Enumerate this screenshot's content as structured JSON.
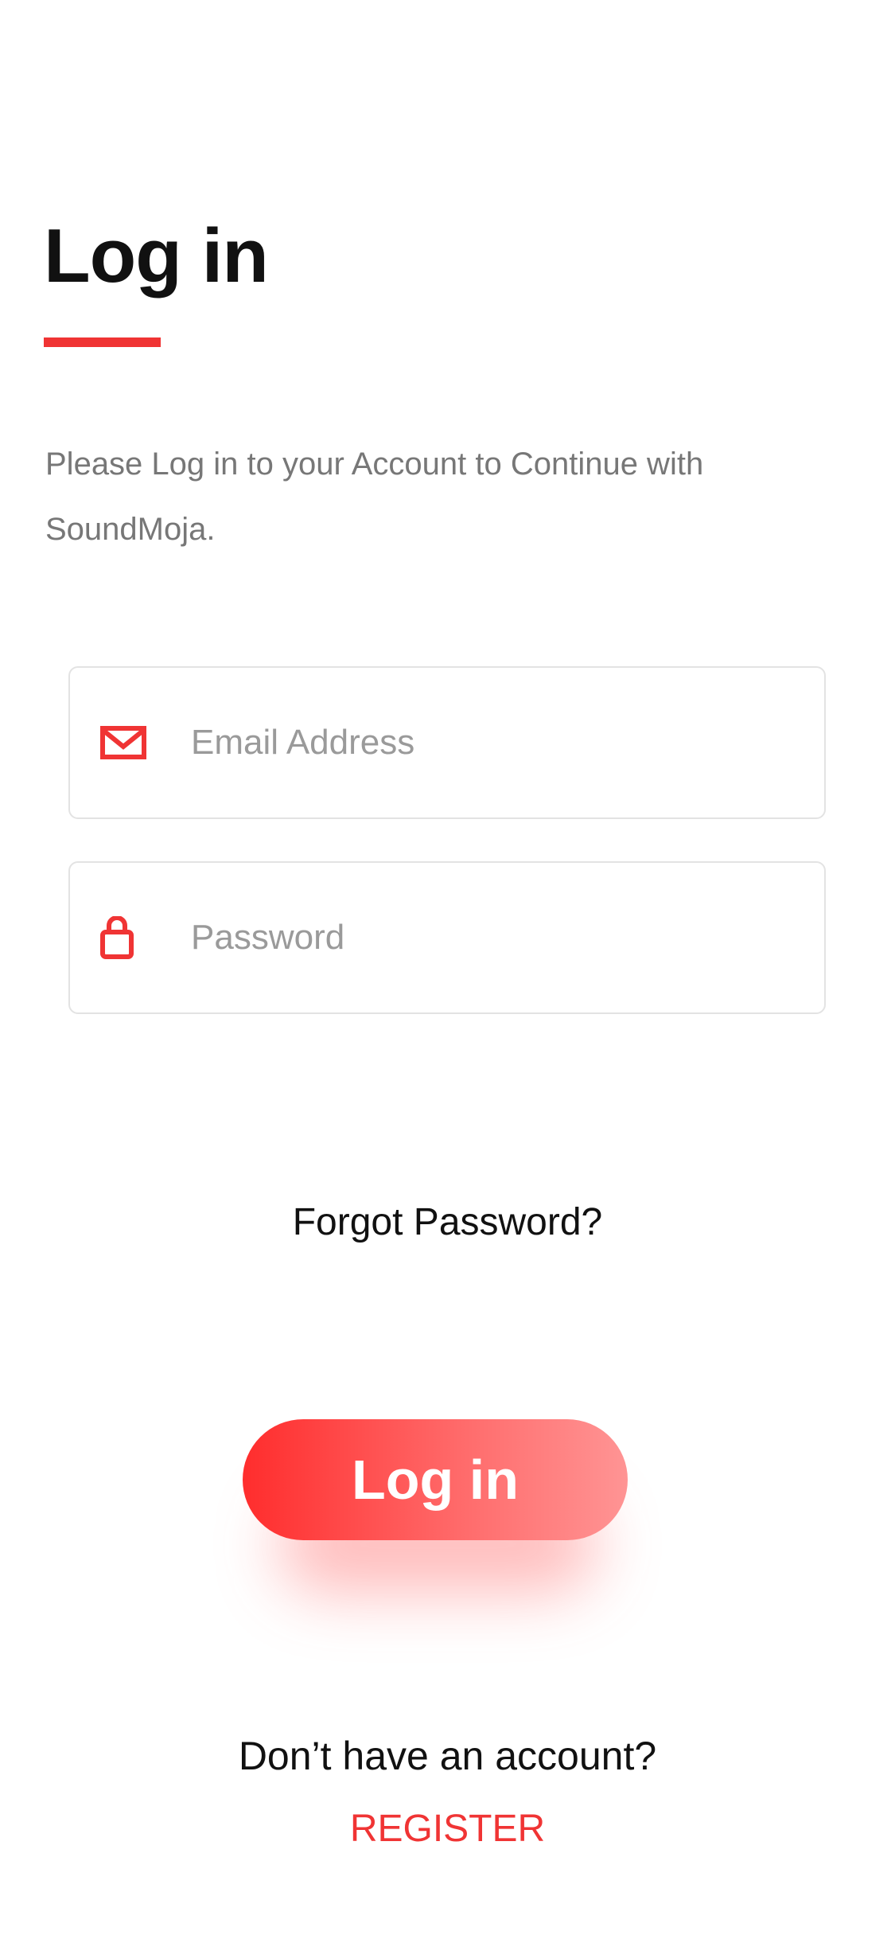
{
  "header": {
    "title": "Log in",
    "subtitle": "Please Log in to your Account to Continue with SoundMoja."
  },
  "form": {
    "email": {
      "placeholder": "Email Address",
      "value": "",
      "icon": "envelope-icon"
    },
    "password": {
      "placeholder": "Password",
      "value": "",
      "icon": "lock-icon"
    },
    "forgot_label": "Forgot Password?",
    "submit_label": "Log in"
  },
  "footer": {
    "prompt": "Don’t have an account?",
    "register_label": "REGISTER"
  },
  "colors": {
    "accent": "#f03434",
    "button_gradient_start": "#ff2d2d",
    "button_gradient_end": "#ff9494"
  }
}
